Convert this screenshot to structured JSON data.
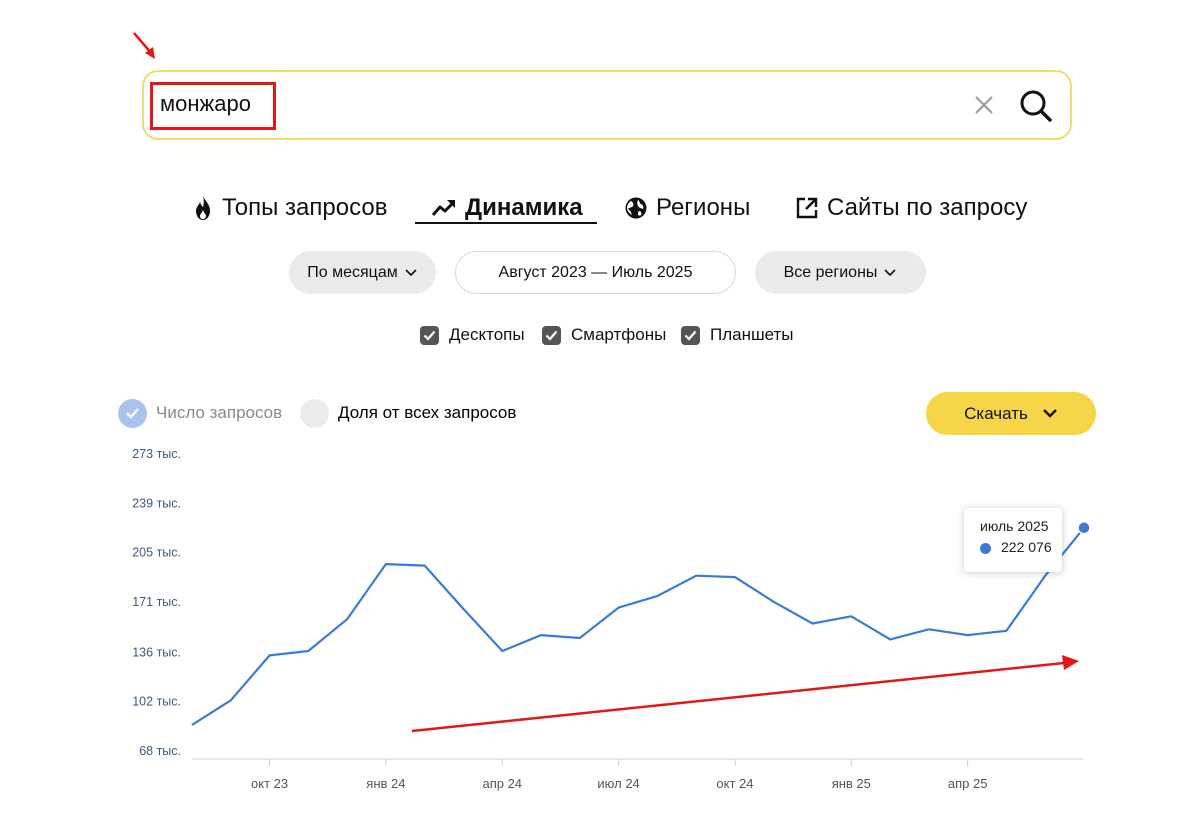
{
  "search": {
    "query": "монжаро"
  },
  "tabs": [
    {
      "label": "Топы запросов",
      "icon": "fire-icon",
      "active": false
    },
    {
      "label": "Динамика",
      "icon": "trend-up-icon",
      "active": true
    },
    {
      "label": "Регионы",
      "icon": "globe-icon",
      "active": false
    },
    {
      "label": "Сайты по запросу",
      "icon": "external-link-icon",
      "active": false
    }
  ],
  "filters": {
    "period_granularity": "По месяцам",
    "date_range": "Август 2023 — Июль 2025",
    "region": "Все регионы"
  },
  "devices": [
    {
      "label": "Десктопы",
      "checked": true
    },
    {
      "label": "Смартфоны",
      "checked": true
    },
    {
      "label": "Планшеты",
      "checked": true
    }
  ],
  "metrics": {
    "count_label": "Число запросов",
    "share_label": "Доля от всех запросов",
    "selected": "count"
  },
  "download_label": "Скачать",
  "tooltip": {
    "date": "июль 2025",
    "value": "222 076"
  },
  "colors": {
    "line": "#3a7bd5",
    "accent": "#f6d548",
    "search_border": "#f0dc6a",
    "annotation": "#e01818"
  },
  "chart_data": {
    "type": "line",
    "y_tick_labels": [
      "273 тыс.",
      "239 тыс.",
      "205 тыс.",
      "171 тыс.",
      "136 тыс.",
      "102 тыс.",
      "68 тыс."
    ],
    "y_ticks": [
      273000,
      239000,
      205000,
      171000,
      136000,
      102000,
      68000
    ],
    "ylim": [
      68000,
      273000
    ],
    "x_tick_labels": [
      "окт 23",
      "янв 24",
      "апр 24",
      "июл 24",
      "окт 24",
      "янв 25",
      "апр 25"
    ],
    "x": [
      "2023-08",
      "2023-09",
      "2023-10",
      "2023-11",
      "2023-12",
      "2024-01",
      "2024-02",
      "2024-03",
      "2024-04",
      "2024-05",
      "2024-06",
      "2024-07",
      "2024-08",
      "2024-09",
      "2024-10",
      "2024-11",
      "2024-12",
      "2025-01",
      "2025-02",
      "2025-03",
      "2025-04",
      "2025-05",
      "2025-06",
      "2025-07"
    ],
    "series": [
      {
        "values": [
          86000,
          103000,
          134000,
          137000,
          159000,
          197000,
          196000,
          166000,
          137000,
          148000,
          146000,
          167000,
          175000,
          189000,
          188000,
          171000,
          156000,
          161000,
          145000,
          152000,
          148000,
          151000,
          189000,
          222076
        ]
      }
    ],
    "grid": false
  }
}
